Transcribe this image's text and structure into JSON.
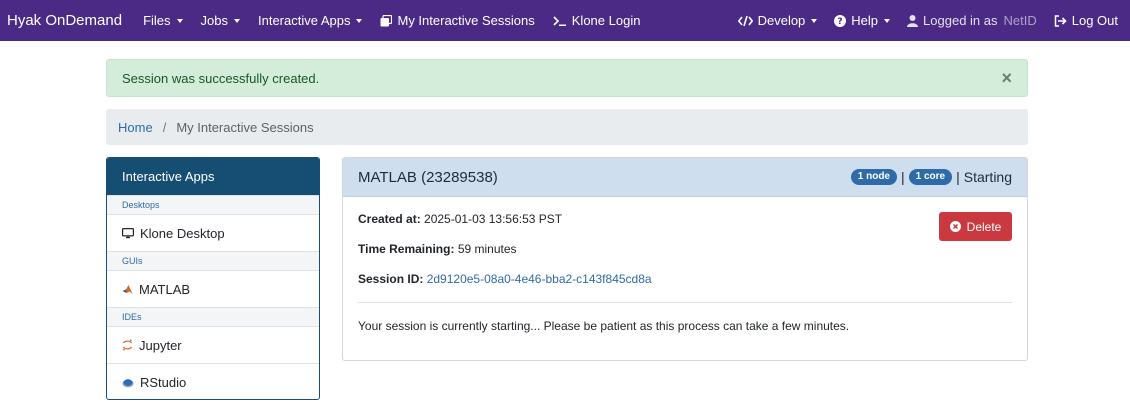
{
  "navbar": {
    "brand": "Hyak OnDemand",
    "left": [
      {
        "label": "Files",
        "dropdown": true
      },
      {
        "label": "Jobs",
        "dropdown": true
      },
      {
        "label": "Interactive Apps",
        "dropdown": true
      },
      {
        "label": "My Interactive Sessions",
        "icon": "sessions-icon"
      },
      {
        "label": "Klone Login",
        "icon": "terminal-icon"
      }
    ],
    "develop": "Develop",
    "help": "Help",
    "logged_in": "Logged in as",
    "user": "NetID",
    "logout": "Log Out",
    "color": "#4b2a85"
  },
  "alert": {
    "message": "Session was successfully created.",
    "close": "×"
  },
  "breadcrumb": {
    "home": "Home",
    "separator": "/",
    "current": "My Interactive Sessions"
  },
  "sidebar": {
    "title": "Interactive Apps",
    "groups": [
      {
        "category": "Desktops",
        "items": [
          {
            "label": "Klone Desktop",
            "icon": "desktop-icon"
          }
        ]
      },
      {
        "category": "GUIs",
        "items": [
          {
            "label": "MATLAB",
            "icon": "matlab-icon"
          }
        ]
      },
      {
        "category": "IDEs",
        "items": [
          {
            "label": "Jupyter",
            "icon": "jupyter-icon"
          },
          {
            "label": "RStudio",
            "icon": "rstudio-icon"
          }
        ]
      }
    ]
  },
  "session": {
    "title": "MATLAB (23289538)",
    "nodes_badge": "1 node",
    "cores_badge": "1 core",
    "separator": "|",
    "status": "Starting",
    "created_label": "Created at:",
    "created_value": "2025-01-03 13:56:53 PST",
    "time_label": "Time Remaining:",
    "time_value": "59 minutes",
    "id_label": "Session ID:",
    "id_value": "2d9120e5-08a0-4e46-bba2-c143f845cd8a",
    "delete_label": "Delete",
    "message": "Your session is currently starting... Please be patient as this process can take a few minutes."
  }
}
